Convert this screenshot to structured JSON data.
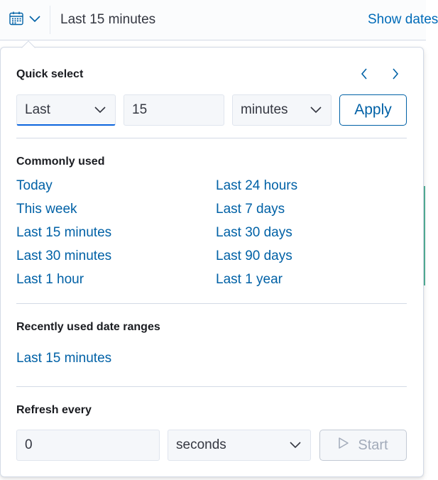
{
  "topbar": {
    "range_text": "Last 15 minutes",
    "show_dates_label": "Show dates"
  },
  "quick_select": {
    "title": "Quick select",
    "tense_value": "Last",
    "amount_value": "15",
    "unit_value": "minutes",
    "apply_label": "Apply"
  },
  "commonly_used": {
    "title": "Commonly used",
    "left": [
      "Today",
      "This week",
      "Last 15 minutes",
      "Last 30 minutes",
      "Last 1 hour"
    ],
    "right": [
      "Last 24 hours",
      "Last 7 days",
      "Last 30 days",
      "Last 90 days",
      "Last 1 year"
    ]
  },
  "recently_used": {
    "title": "Recently used date ranges",
    "items": [
      "Last 15 minutes"
    ]
  },
  "refresh": {
    "title": "Refresh every",
    "interval_value": "0",
    "unit_value": "seconds",
    "start_label": "Start"
  },
  "icons": {
    "calendar": "calendar-icon",
    "chevron_down": "chevron-down-icon",
    "prev": "chevron-left-icon",
    "next": "chevron-right-icon",
    "play": "play-icon"
  },
  "colors": {
    "link": "#0061a6",
    "accent": "#0b64dd",
    "border": "#d3dae6"
  }
}
